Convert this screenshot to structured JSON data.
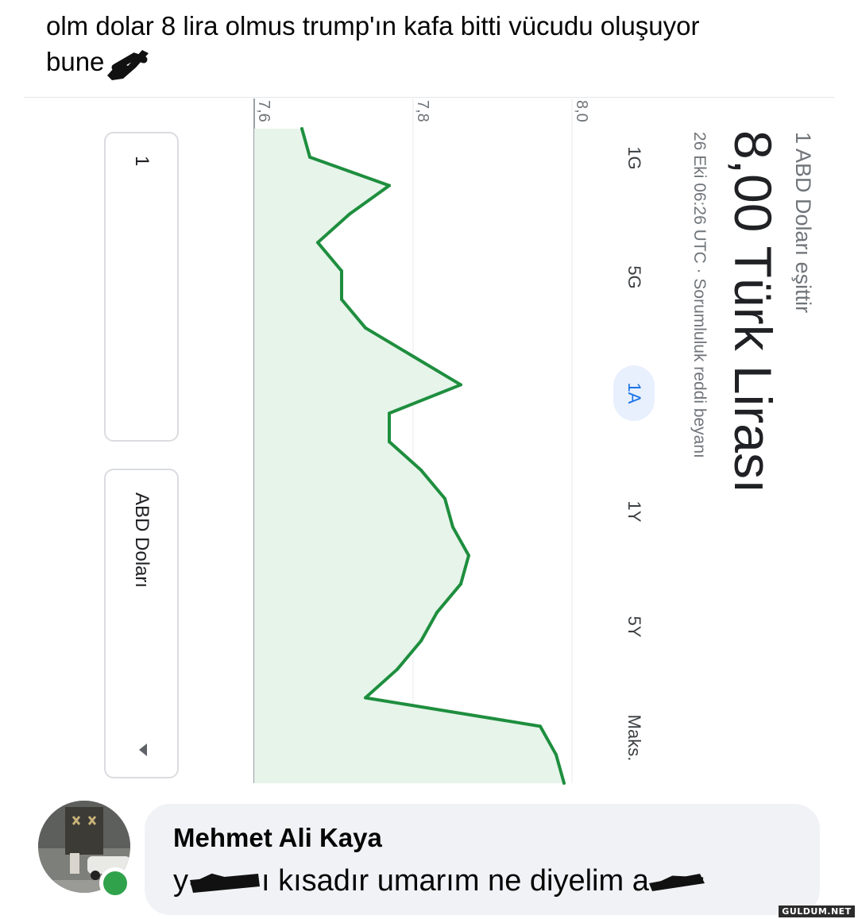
{
  "post": {
    "line1": "olm dolar 8 lira olmus trump'ın kafa bitti vücudu oluşuyor",
    "line2": "bune"
  },
  "widget": {
    "equals_label": "1 ABD Doları eşittir",
    "value": "8,00 Türk Lirası",
    "date_line": "26 Eki 06:26 UTC · Sorumluluk reddi beyanı",
    "ranges": [
      "1G",
      "5G",
      "1A",
      "1Y",
      "5Y",
      "Maks."
    ],
    "active_range": "1A",
    "from_amount": "1",
    "from_currency": "ABD Doları",
    "to_amount": "8,00",
    "to_currency": "Türk Lirası"
  },
  "chart_data": {
    "type": "area",
    "x": [
      0,
      1,
      2,
      3,
      4,
      5,
      6,
      7,
      8,
      9,
      10,
      11,
      12,
      13,
      14,
      15,
      16,
      17,
      18,
      19,
      20,
      21,
      22,
      23
    ],
    "values": [
      7.66,
      7.67,
      7.77,
      7.72,
      7.68,
      7.71,
      7.71,
      7.74,
      7.8,
      7.86,
      7.77,
      7.77,
      7.81,
      7.84,
      7.85,
      7.87,
      7.86,
      7.83,
      7.81,
      7.78,
      7.74,
      7.96,
      7.98,
      7.99
    ],
    "yticks": [
      "7,6",
      "7,8",
      "8,0"
    ],
    "ylim": [
      7.6,
      8.0
    ],
    "line_color": "#1e8e3e",
    "fill_color": "#e6f4ea"
  },
  "comment": {
    "author": "Mehmet Ali Kaya",
    "text_start": "y",
    "text_middle": "ı kısadır umarım ne diyelim a"
  },
  "watermark": "GULDUM.NET",
  "colors": {
    "link_blue": "#1a73e8",
    "online_green": "#31a24c",
    "bubble_bg": "#f0f2f5"
  }
}
